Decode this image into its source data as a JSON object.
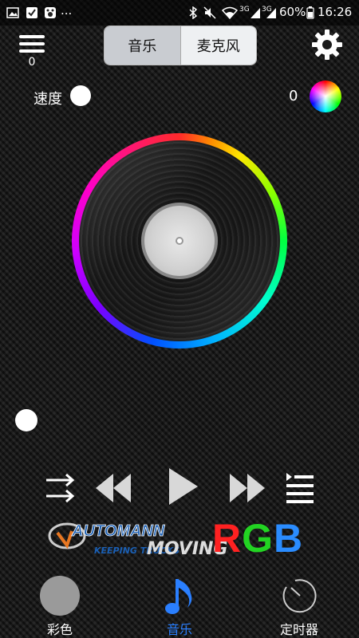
{
  "status_bar": {
    "time": "16:26",
    "battery": "60%",
    "network_1": "3G",
    "network_2": "3G",
    "more": "..."
  },
  "header": {
    "menu_count": "0",
    "tabs": {
      "music": "音乐",
      "microphone": "麦克风"
    }
  },
  "speed": {
    "label": "速度"
  },
  "color": {
    "value": "0"
  },
  "brand": {
    "name": "AUTOMANN",
    "tagline_1": "KEEPING TRUCKS",
    "tagline_2": "MOVING",
    "rgb_r": "R",
    "rgb_g": "G",
    "rgb_b": "B"
  },
  "bottom_nav": {
    "color": "彩色",
    "music": "音乐",
    "timer": "定时器",
    "active": "music",
    "active_color": "#2a7fff"
  },
  "icons": [
    "menu-icon",
    "settings-gear-icon",
    "shuffle-icon",
    "previous-icon",
    "play-icon",
    "next-icon",
    "playlist-icon",
    "music-note-icon",
    "timer-icon"
  ]
}
